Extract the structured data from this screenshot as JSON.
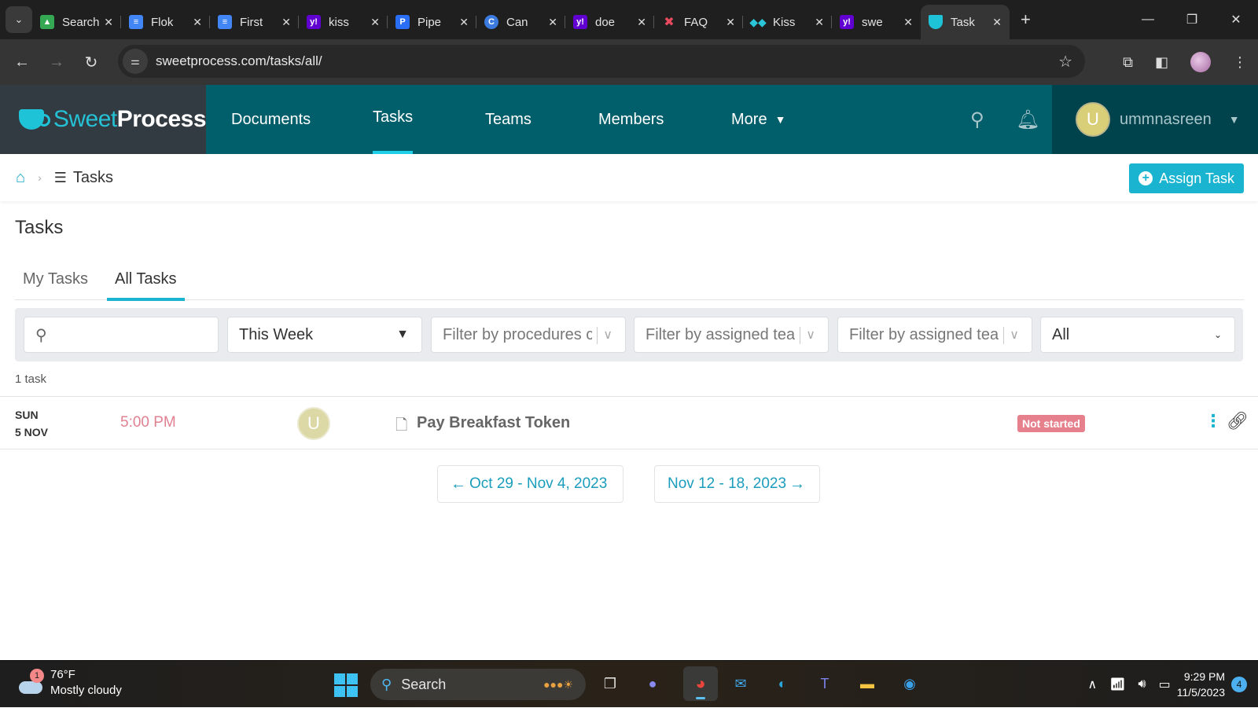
{
  "browser": {
    "tabs": [
      {
        "title": "Search",
        "icon": "google-drive-icon",
        "color": "#34a853"
      },
      {
        "title": "Flok",
        "icon": "google-docs-icon",
        "color": "#4285f4"
      },
      {
        "title": "First",
        "icon": "google-docs-icon",
        "color": "#4285f4"
      },
      {
        "title": "kiss",
        "icon": "yahoo-icon",
        "color": "#6001d2"
      },
      {
        "title": "Pipe",
        "icon": "pipedrive-icon",
        "color": "#2a6ef5"
      },
      {
        "title": "Can",
        "icon": "canva-icon",
        "color": "#3b7be0"
      },
      {
        "title": "doe",
        "icon": "yahoo-icon",
        "color": "#6001d2"
      },
      {
        "title": "FAQ",
        "icon": "pinwheel-icon",
        "color": "#e84a5f"
      },
      {
        "title": "Kiss",
        "icon": "kissflow-icon",
        "color": "#2ac5d8"
      },
      {
        "title": "swe",
        "icon": "yahoo-icon",
        "color": "#6001d2"
      },
      {
        "title": "Task",
        "icon": "sweetprocess-icon",
        "color": "#1fc3d8",
        "active": true
      }
    ],
    "url": "sweetprocess.com/tasks/all/"
  },
  "app": {
    "logo_sweet": "Sweet",
    "logo_process": "Process",
    "nav": [
      {
        "label": "Documents"
      },
      {
        "label": "Tasks",
        "active": true
      },
      {
        "label": "Teams"
      },
      {
        "label": "Members"
      },
      {
        "label": "More"
      }
    ],
    "user": {
      "initial": "U",
      "name": "ummnasreen"
    },
    "colors": {
      "nav_bg": "#005f6b",
      "logo_bg": "#323a42",
      "user_bg": "#00434d",
      "accent": "#1ab4d0"
    }
  },
  "breadcrumb": {
    "current": "Tasks"
  },
  "assign_button": {
    "label": "Assign Task"
  },
  "page": {
    "title": "Tasks",
    "tabs": [
      {
        "label": "My Tasks"
      },
      {
        "label": "All Tasks",
        "active": true
      }
    ]
  },
  "filters": {
    "search_placeholder": "",
    "period": "This Week",
    "procedures_placeholder": "Filter by procedures c",
    "team1_placeholder": "Filter by assigned tea",
    "team2_placeholder": "Filter by assigned tea",
    "status": "All"
  },
  "task_count": "1 task",
  "tasks": [
    {
      "day": "SUN",
      "date": "5 NOV",
      "time": "5:00 PM",
      "assignee_initial": "U",
      "name": "Pay Breakfast Token",
      "status": "Not started",
      "status_color": "#e6808c"
    }
  ],
  "pagination": {
    "prev": "Oct 29 - Nov 4, 2023",
    "next": "Nov 12 - 18, 2023"
  },
  "taskbar": {
    "weather_temp": "76°F",
    "weather_desc": "Mostly cloudy",
    "weather_badge": "1",
    "search_label": "Search",
    "time": "9:29 PM",
    "date": "11/5/2023",
    "notifications": "4"
  }
}
